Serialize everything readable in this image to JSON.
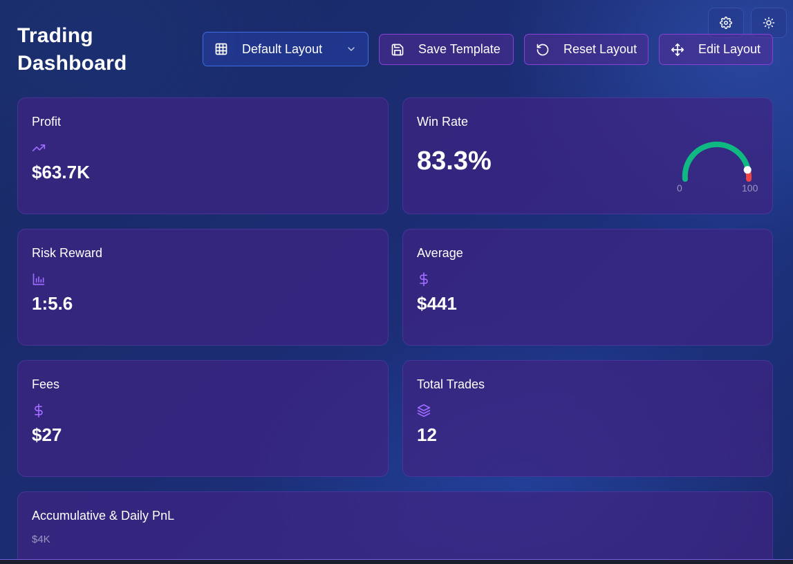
{
  "header": {
    "title_line1": "Trading",
    "title_line2": "Dashboard"
  },
  "toolbar": {
    "layout_select": "Default Layout",
    "save_template": "Save Template",
    "reset_layout": "Reset Layout",
    "edit_layout": "Edit Layout"
  },
  "icons": {
    "settings": "gear-icon",
    "theme": "sun-icon",
    "layout": "grid-icon",
    "save": "floppy-disk-icon",
    "reset": "rotate-ccw-icon",
    "edit": "move-icon"
  },
  "cards": {
    "profit": {
      "label": "Profit",
      "value": "$63.7K",
      "icon": "trending-up-icon"
    },
    "win_rate": {
      "label": "Win Rate",
      "value": "83.3%",
      "gauge_min": "0",
      "gauge_max": "100",
      "gauge_level": 83.3
    },
    "risk_reward": {
      "label": "Risk Reward",
      "value": "1:5.6",
      "icon": "bar-chart-icon"
    },
    "average": {
      "label": "Average",
      "value": "$441",
      "icon": "dollar-icon"
    },
    "fees": {
      "label": "Fees",
      "value": "$27",
      "icon": "dollar-icon"
    },
    "total_trades": {
      "label": "Total Trades",
      "value": "12",
      "icon": "layers-icon"
    },
    "pnl": {
      "label": "Accumulative & Daily PnL",
      "y_tick_top": "$4K"
    }
  },
  "colors": {
    "accent_purple": "#a06bff",
    "gauge_green": "#10b981",
    "gauge_red": "#ef4444"
  }
}
